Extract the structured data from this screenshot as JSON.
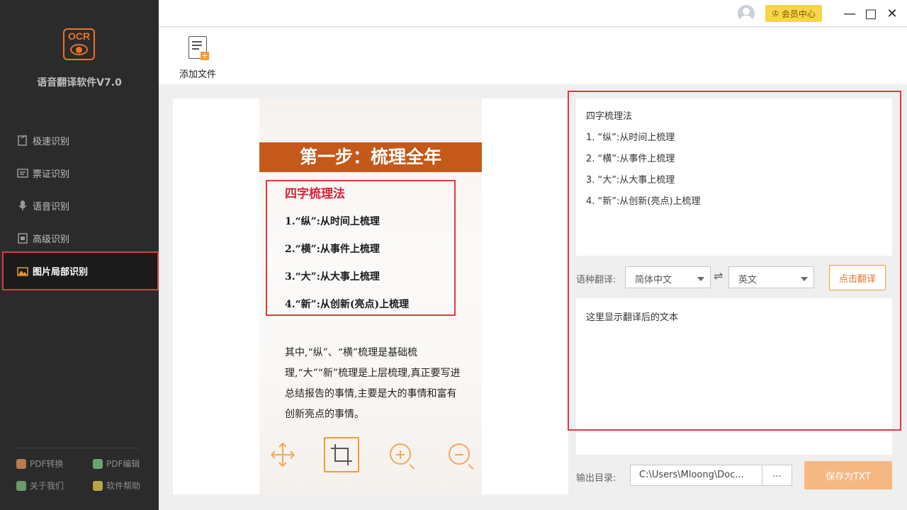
{
  "app": {
    "title": "语音翻译软件V7.0",
    "logo_text": "OCR"
  },
  "sidebar": {
    "items": [
      {
        "label": "极速识别",
        "icon": "fast-recognition-icon"
      },
      {
        "label": "票证识别",
        "icon": "ticket-recognition-icon"
      },
      {
        "label": "语音识别",
        "icon": "microphone-icon"
      },
      {
        "label": "高级识别",
        "icon": "advanced-recognition-icon"
      },
      {
        "label": "图片局部识别",
        "icon": "image-region-icon",
        "active": true
      }
    ],
    "footer_links": [
      {
        "label": "PDF转换",
        "icon": "pdf-convert-icon"
      },
      {
        "label": "PDF编辑",
        "icon": "pdf-edit-icon"
      },
      {
        "label": "关于我们",
        "icon": "about-icon"
      },
      {
        "label": "软件帮助",
        "icon": "help-icon"
      }
    ]
  },
  "topbar": {
    "vip_label": "会员中心",
    "crown_glyph": "♔",
    "minimize": "—",
    "maximize": "□",
    "close": "✕"
  },
  "toolbar": {
    "add_file_label": "添加文件"
  },
  "document": {
    "banner": "第一步：梳理全年",
    "heading": "四字梳理法",
    "items": [
      "1.“纵”:从时间上梳理",
      "2.“横”:从事件上梳理",
      "3.“大”:从大事上梳理",
      "4.“新”:从创新(亮点)上梳理"
    ],
    "paragraph": "其中,“纵”、“横”梳理是基础梳理,“大”“新”梳理是上层梳理,真正要写进总结报告的事情,主要是大的事情和富有创新亮点的事情。"
  },
  "ocr_result": {
    "lines": [
      "四字梳理法",
      "1. “纵”:从时间上梳理",
      "2. “横”:从事件上梳理",
      "3. “大”:从大事上梳理",
      "4. “新”:从创新(亮点)上梳理"
    ]
  },
  "translation": {
    "label": "语种翻译:",
    "source_lang": "简体中文",
    "target_lang": "英文",
    "swap_glyph": "⇌",
    "button_label": "点击翻译",
    "output_placeholder": "这里显示翻译后的文本"
  },
  "output": {
    "label": "输出目录:",
    "path": "C:\\Users\\Mloong\\Doc...",
    "browse_label": "...",
    "save_label": "保存为TXT"
  },
  "colors": {
    "accent": "#f29a38",
    "highlight_red": "#e0393e",
    "sidebar_bg": "#2b2b2b",
    "banner": "#c4591a",
    "vip": "#f8d44a"
  }
}
